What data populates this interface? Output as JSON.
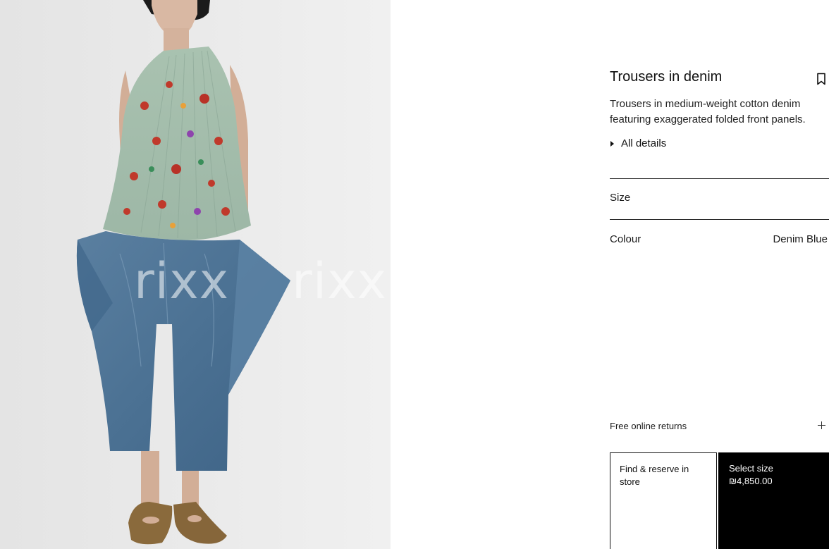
{
  "product": {
    "title": "Trousers in denim",
    "description": "Trousers in medium-weight cotton denim featuring exaggerated folded front panels.",
    "all_details_label": "All details"
  },
  "image": {
    "watermark_text": "rixx"
  },
  "size": {
    "label": "Size"
  },
  "colour": {
    "label": "Colour",
    "value": "Denim Blue"
  },
  "returns": {
    "label": "Free online returns"
  },
  "actions": {
    "find_reserve_label": "Find & reserve in store",
    "select_size_label": "Select size",
    "price": "₪4,850.00"
  },
  "colors": {
    "background": "#ffffff",
    "text": "#111111",
    "primary_button": "#000000",
    "primary_button_text": "#ffffff",
    "image_background": "#e9e9e9",
    "denim": "#4f7494"
  },
  "icons": {
    "bookmark": "bookmark-icon",
    "expand": "triangle-right-icon",
    "returns_toggle": "plus-icon"
  }
}
